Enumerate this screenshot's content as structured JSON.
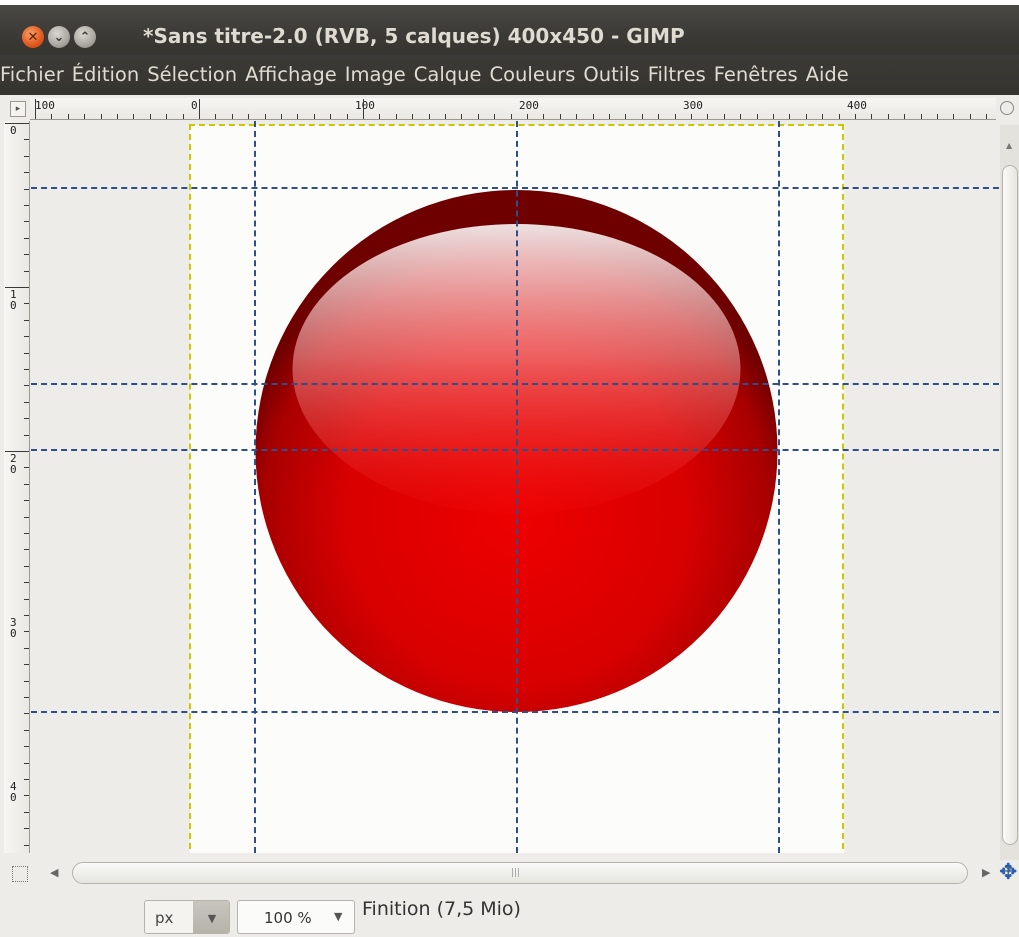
{
  "window": {
    "title": "*Sans titre-2.0 (RVB, 5 calques) 400x450 - GIMP",
    "close_glyph": "✕",
    "minimize_glyph": "⌄",
    "maximize_glyph": "⌃"
  },
  "menubar": {
    "items": [
      {
        "label": "Fichier"
      },
      {
        "label": "Édition"
      },
      {
        "label": "Sélection"
      },
      {
        "label": "Affichage"
      },
      {
        "label": "Image"
      },
      {
        "label": "Calque"
      },
      {
        "label": "Couleurs"
      },
      {
        "label": "Outils"
      },
      {
        "label": "Filtres"
      },
      {
        "label": "Fenêtres"
      },
      {
        "label": "Aide"
      }
    ]
  },
  "rulers": {
    "horizontal_labels": [
      "100",
      "0",
      "100",
      "200",
      "300",
      "400"
    ],
    "vertical_labels": [
      "0",
      "10",
      "20",
      "30",
      "40"
    ]
  },
  "canvas": {
    "image_width": 400,
    "image_height": 450,
    "layers_count": 5,
    "colors": {
      "sphere": "#e00000",
      "sphere_dark": "#8a0000",
      "highlight": "#ffffff",
      "guide": "#2f4f8c",
      "layer_boundary": "#c9c900",
      "background": "#fcfcfa"
    }
  },
  "statusbar": {
    "unit": "px",
    "zoom": "100 %",
    "message": "Finition (7,5 Mio)",
    "dropdown_glyph": "▼"
  },
  "scrollbars": {
    "left_arrow": "◀",
    "right_arrow": "▶",
    "up_arrow": "▲",
    "down_arrow": "▼",
    "grip": "|||"
  },
  "icons": {
    "navigate": "✥",
    "nav_toggle": "▸"
  }
}
